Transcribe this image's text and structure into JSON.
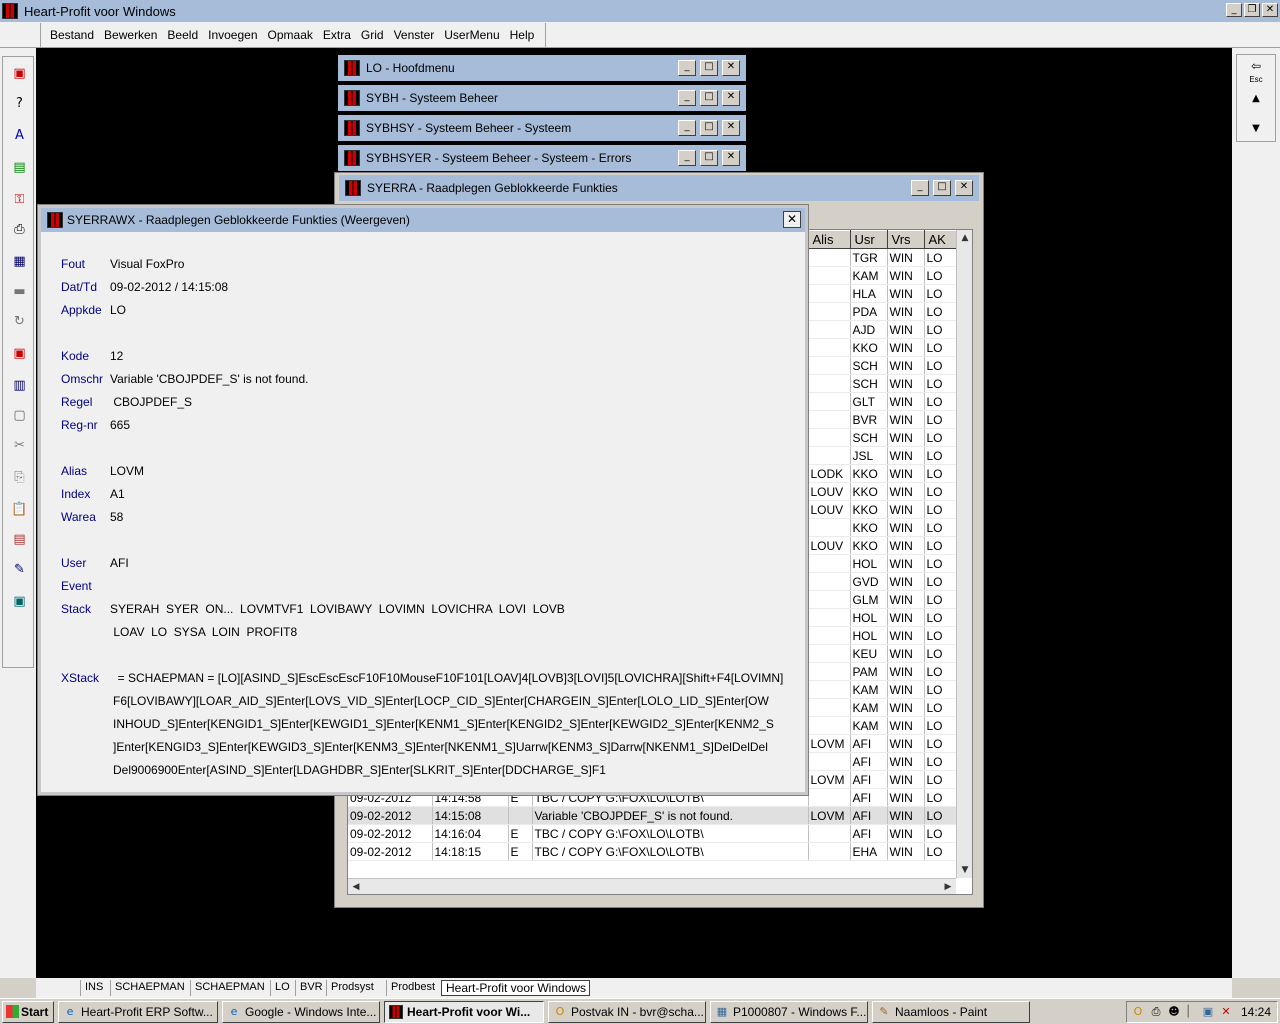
{
  "app": {
    "title": "Heart-Profit voor Windows"
  },
  "menu": [
    "Bestand",
    "Bewerken",
    "Beeld",
    "Invoegen",
    "Opmaak",
    "Extra",
    "Grid",
    "Venster",
    "UserMenu",
    "Help"
  ],
  "toolbar_right": {
    "esc_label": "Esc"
  },
  "mdi_windows": [
    "LO - Hoofdmenu",
    "SYBH - Systeem Beheer",
    "SYBHSY - Systeem Beheer - Systeem",
    "SYBHSYER - Systeem Beheer - Systeem - Errors",
    "SYERRA - Raadplegen Geblokkeerde Funkties"
  ],
  "grid": {
    "headers": [
      "Alis",
      "Usr",
      "Vrs",
      "AK"
    ],
    "rows": [
      {
        "alis": "",
        "usr": "TGR",
        "vrs": "WIN",
        "ak": "LO"
      },
      {
        "alis": "",
        "usr": "KAM",
        "vrs": "WIN",
        "ak": "LO"
      },
      {
        "alis": "",
        "usr": "HLA",
        "vrs": "WIN",
        "ak": "LO"
      },
      {
        "alis": "",
        "usr": "PDA",
        "vrs": "WIN",
        "ak": "LO"
      },
      {
        "alis": "",
        "usr": "AJD",
        "vrs": "WIN",
        "ak": "LO"
      },
      {
        "alis": "",
        "usr": "KKO",
        "vrs": "WIN",
        "ak": "LO"
      },
      {
        "alis": "",
        "usr": "SCH",
        "vrs": "WIN",
        "ak": "LO"
      },
      {
        "alis": "",
        "usr": "SCH",
        "vrs": "WIN",
        "ak": "LO"
      },
      {
        "alis": "",
        "usr": "GLT",
        "vrs": "WIN",
        "ak": "LO"
      },
      {
        "alis": "",
        "usr": "BVR",
        "vrs": "WIN",
        "ak": "LO"
      },
      {
        "alis": "",
        "usr": "SCH",
        "vrs": "WIN",
        "ak": "LO"
      },
      {
        "alis": "",
        "usr": "JSL",
        "vrs": "WIN",
        "ak": "LO"
      },
      {
        "alis": "LODK",
        "usr": "KKO",
        "vrs": "WIN",
        "ak": "LO"
      },
      {
        "alis": "LOUV",
        "usr": "KKO",
        "vrs": "WIN",
        "ak": "LO"
      },
      {
        "alis": "LOUV",
        "usr": "KKO",
        "vrs": "WIN",
        "ak": "LO"
      },
      {
        "alis": "",
        "usr": "KKO",
        "vrs": "WIN",
        "ak": "LO"
      },
      {
        "alis": "LOUV",
        "usr": "KKO",
        "vrs": "WIN",
        "ak": "LO"
      },
      {
        "alis": "",
        "usr": "HOL",
        "vrs": "WIN",
        "ak": "LO"
      },
      {
        "alis": "",
        "usr": "GVD",
        "vrs": "WIN",
        "ak": "LO"
      },
      {
        "alis": "",
        "usr": "GLM",
        "vrs": "WIN",
        "ak": "LO"
      },
      {
        "alis": "",
        "usr": "HOL",
        "vrs": "WIN",
        "ak": "LO"
      },
      {
        "alis": "",
        "usr": "HOL",
        "vrs": "WIN",
        "ak": "LO"
      },
      {
        "alis": "",
        "usr": "KEU",
        "vrs": "WIN",
        "ak": "LO"
      },
      {
        "alis": "",
        "usr": "PAM",
        "vrs": "WIN",
        "ak": "LO"
      },
      {
        "alis": "",
        "usr": "KAM",
        "vrs": "WIN",
        "ak": "LO"
      },
      {
        "alis": "",
        "usr": "KAM",
        "vrs": "WIN",
        "ak": "LO"
      },
      {
        "alis": "",
        "usr": "KAM",
        "vrs": "WIN",
        "ak": "LO"
      },
      {
        "alis": "LOVM",
        "usr": "AFI",
        "vrs": "WIN",
        "ak": "LO"
      },
      {
        "alis": "",
        "usr": "AFI",
        "vrs": "WIN",
        "ak": "LO"
      },
      {
        "alis": "LOVM",
        "usr": "AFI",
        "vrs": "WIN",
        "ak": "LO"
      }
    ],
    "full_rows": [
      {
        "date": "09-02-2012",
        "time": "14:14:58",
        "e": "E",
        "msg": "TBC / COPY G:\\FOX\\LO\\LOTB\\",
        "alis": "",
        "usr": "AFI",
        "vrs": "WIN",
        "ak": "LO"
      },
      {
        "date": "09-02-2012",
        "time": "14:15:08",
        "e": "",
        "msg": "Variable 'CBOJPDEF_S' is not found.",
        "alis": "LOVM",
        "usr": "AFI",
        "vrs": "WIN",
        "ak": "LO"
      },
      {
        "date": "09-02-2012",
        "time": "14:16:04",
        "e": "E",
        "msg": "TBC / COPY G:\\FOX\\LO\\LOTB\\",
        "alis": "",
        "usr": "AFI",
        "vrs": "WIN",
        "ak": "LO"
      },
      {
        "date": "09-02-2012",
        "time": "14:18:15",
        "e": "E",
        "msg": "TBC / COPY G:\\FOX\\LO\\LOTB\\",
        "alis": "",
        "usr": "EHA",
        "vrs": "WIN",
        "ak": "LO"
      }
    ]
  },
  "dialog": {
    "title": "SYERRAWX - Raadplegen Geblokkeerde Funkties (Weergeven)",
    "close_label": "✕",
    "fields": {
      "fout": {
        "label": "Fout",
        "value": "Visual FoxPro"
      },
      "dattd": {
        "label": "Dat/Td",
        "value": "09-02-2012 / 14:15:08"
      },
      "appkde": {
        "label": "Appkde",
        "value": "LO"
      },
      "kode": {
        "label": "Kode",
        "value": "12"
      },
      "omschr": {
        "label": "Omschr",
        "value": "Variable 'CBOJPDEF_S' is not found."
      },
      "regel": {
        "label": "Regel",
        "value": " CBOJPDEF_S"
      },
      "regnr": {
        "label": "Reg-nr",
        "value": "665"
      },
      "alias": {
        "label": "Alias",
        "value": "LOVM"
      },
      "index": {
        "label": "Index",
        "value": "A1"
      },
      "warea": {
        "label": "Warea",
        "value": "58"
      },
      "user": {
        "label": "User",
        "value": "AFI"
      },
      "event": {
        "label": "Event",
        "value": ""
      },
      "stack": {
        "label": "Stack",
        "value": "SYERAH  SYER  ON...  LOVMTVF1  LOVIBAWY  LOVIMN  LOVICHRA  LOVI  LOVB"
      },
      "stack2": {
        "label": "",
        "value": " LOAV  LO  SYSA  LOIN  PROFIT8"
      },
      "xstack": {
        "label": "XStack",
        "value": "  = SCHAEPMAN = [LO][ASIND_S]EscEscEscF10F10MouseF10F101[LOAV]4[LOVB]3[LOVI]5[LOVICHRA][Shift+F4[LOVIMN]"
      },
      "xstack2": {
        "label": "",
        "value": "F6[LOVIBAWY][LOAR_AID_S]Enter[LOVS_VID_S]Enter[LOCP_CID_S]Enter[CHARGEIN_S]Enter[LOLO_LID_S]Enter[OW"
      },
      "xstack3": {
        "label": "",
        "value": "INHOUD_S]Enter[KENGID1_S]Enter[KEWGID1_S]Enter[KENM1_S]Enter[KENGID2_S]Enter[KEWGID2_S]Enter[KENM2_S"
      },
      "xstack4": {
        "label": "",
        "value": "]Enter[KENGID3_S]Enter[KEWGID3_S]Enter[KENM3_S]Enter[NKENM1_S]Uarrw[KENM3_S]Darrw[NKENM1_S]DelDelDel"
      },
      "xstack5": {
        "label": "",
        "value": "Del9006900Enter[ASIND_S]Enter[LDAGHDBR_S]Enter[SLKRIT_S]Enter[DDCHARGE_S]F1"
      }
    }
  },
  "statusbar": [
    "INS",
    "SCHAEPMAN",
    "SCHAEPMAN",
    "LO",
    "BVR",
    "Prodsyst",
    "Prodbest",
    "Heart-Profit voor Windows"
  ],
  "taskbar": {
    "start": "Start",
    "items": [
      {
        "label": "Heart-Profit ERP Softw...",
        "icon": "e"
      },
      {
        "label": "Google - Windows Inte...",
        "icon": "e"
      },
      {
        "label": "Heart-Profit voor Wi...",
        "icon": "hp",
        "active": true
      },
      {
        "label": "Postvak IN - bvr@scha...",
        "icon": "O"
      },
      {
        "label": "P1000807 - Windows F...",
        "icon": "▦"
      },
      {
        "label": "Naamloos - Paint",
        "icon": "✎"
      }
    ],
    "clock": "14:24"
  }
}
